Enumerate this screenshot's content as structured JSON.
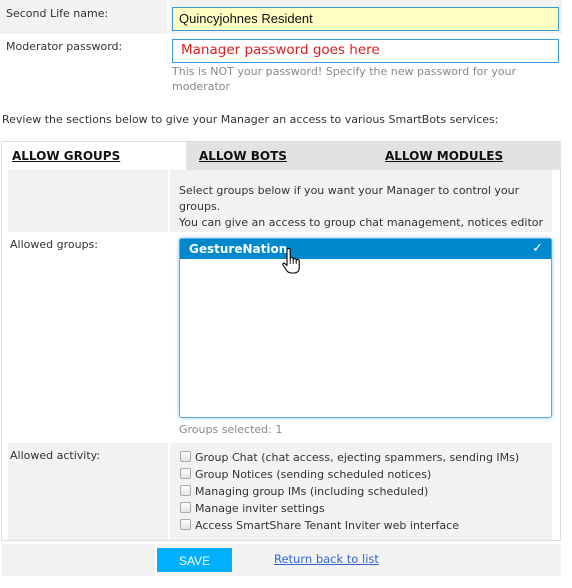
{
  "form": {
    "second_life_name": {
      "label": "Second Life name:",
      "value": "Quincyjohnes Resident"
    },
    "moderator_password": {
      "label": "Moderator password:",
      "placeholder": "Manager password goes here",
      "help_line1": "This is NOT your password! Specify the new password for your",
      "help_line2": "moderator"
    }
  },
  "intro_text": "Review the sections below to give your Manager an access to various SmartBots services:",
  "tabs": [
    {
      "label": "ALLOW GROUPS",
      "active": true
    },
    {
      "label": "ALLOW BOTS",
      "active": false
    },
    {
      "label": "ALLOW MODULES",
      "active": false
    }
  ],
  "groups_tab": {
    "description_line1": "Select groups below if you want your Manager to control your groups.",
    "description_line2": "You can give an access to group chat management, notices editor etc.",
    "allowed_groups_label": "Allowed groups:",
    "groups": [
      {
        "name": "GestureNation",
        "selected": true,
        "check_glyph": "✓"
      }
    ],
    "groups_selected_text": "Groups selected: 1",
    "allowed_activity_label": "Allowed activity:",
    "activities": [
      {
        "label": "Group Chat (chat access, ejecting spammers, sending IMs)",
        "checked": false
      },
      {
        "label": "Group Notices (sending scheduled notices)",
        "checked": false
      },
      {
        "label": "Managing group IMs (including scheduled)",
        "checked": false
      },
      {
        "label": "Manage inviter settings",
        "checked": false
      },
      {
        "label": "Access SmartShare Tenant Inviter web interface",
        "checked": false
      }
    ]
  },
  "footer": {
    "save_label": "SAVE",
    "return_label": "Return back to list"
  },
  "colors": {
    "selected_option_bg": "#0088cc",
    "save_button_bg": "#00b0ff",
    "placeholder_text": "#e31b1b",
    "name_input_bg": "#ffffc4",
    "input_border": "#3a9ad9"
  }
}
